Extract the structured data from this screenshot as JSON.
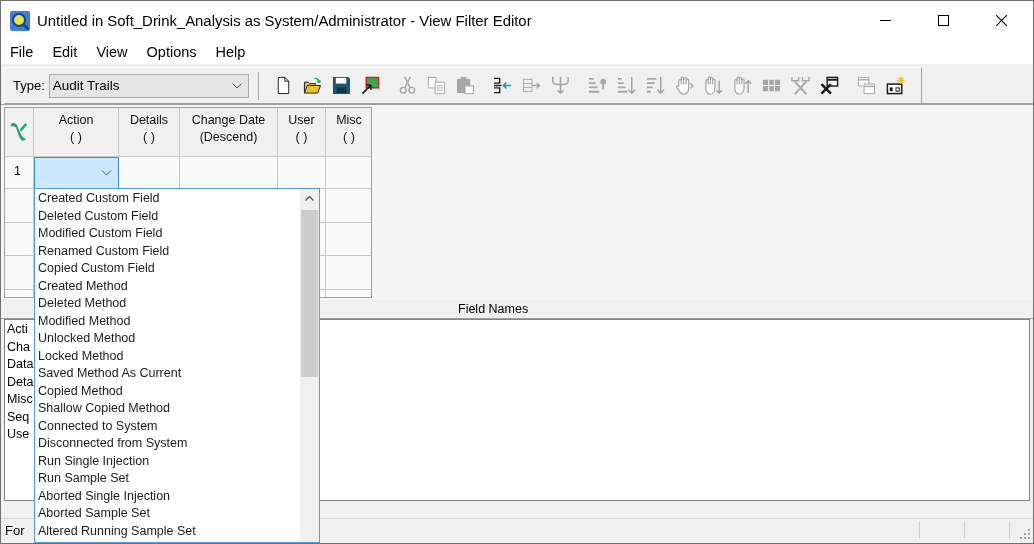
{
  "window": {
    "title": "Untitled in Soft_Drink_Analysis as System/Administrator - View Filter Editor"
  },
  "menu": [
    "File",
    "Edit",
    "View",
    "Options",
    "Help"
  ],
  "toolbar": {
    "type_label": "Type:",
    "type_field": {
      "value": "Audit Trails"
    },
    "button_groups": [
      [
        {
          "kind": "new",
          "disabled": false
        },
        {
          "kind": "open",
          "disabled": false
        },
        {
          "kind": "save",
          "disabled": false
        },
        {
          "kind": "preview",
          "disabled": false
        }
      ],
      [
        {
          "kind": "cut",
          "disabled": true
        },
        {
          "kind": "copy",
          "disabled": true
        },
        {
          "kind": "paste",
          "disabled": true
        }
      ],
      [
        {
          "kind": "insert_column",
          "disabled": false
        },
        {
          "kind": "move_column",
          "disabled": true
        },
        {
          "kind": "branch",
          "disabled": true
        }
      ],
      [
        {
          "kind": "sort_query",
          "disabled": true
        },
        {
          "kind": "sort_ascending",
          "disabled": true
        },
        {
          "kind": "sort_descending",
          "disabled": true
        },
        {
          "kind": "hand",
          "disabled": true
        },
        {
          "kind": "hand_down",
          "disabled": true
        },
        {
          "kind": "hand_up",
          "disabled": true
        },
        {
          "kind": "grid_block",
          "disabled": true
        },
        {
          "kind": "cross_fork",
          "disabled": true
        },
        {
          "kind": "window_x",
          "disabled": false
        }
      ],
      [
        {
          "kind": "windows",
          "disabled": true
        },
        {
          "kind": "sparkle_box",
          "disabled": false
        }
      ]
    ]
  },
  "grid": {
    "columns": [
      {
        "title": "Action",
        "order": "( )"
      },
      {
        "title": "Details",
        "order": "( )"
      },
      {
        "title": "Change Date",
        "order": "(Descend)"
      },
      {
        "title": "User",
        "order": "( )"
      },
      {
        "title": "Misc",
        "order": "( )"
      }
    ],
    "rows": [
      {
        "header": "1",
        "cells": [
          {
            "selected": true
          },
          {
            "selected": false
          },
          {
            "selected": false
          },
          {
            "selected": false
          },
          {
            "selected": false
          }
        ]
      }
    ]
  },
  "dropdown": {
    "items": [
      {
        "label": "Created Custom Field",
        "selected": false
      },
      {
        "label": "Deleted Custom Field",
        "selected": false
      },
      {
        "label": "Modified Custom Field",
        "selected": false
      },
      {
        "label": "Renamed Custom Field",
        "selected": false
      },
      {
        "label": "Copied Custom Field",
        "selected": false
      },
      {
        "label": "Created Method",
        "selected": false
      },
      {
        "label": "Deleted Method",
        "selected": false
      },
      {
        "label": "Modified Method",
        "selected": false
      },
      {
        "label": "Unlocked Method",
        "selected": false
      },
      {
        "label": "Locked Method",
        "selected": false
      },
      {
        "label": "Saved Method As Current",
        "selected": false
      },
      {
        "label": "Copied Method",
        "selected": false
      },
      {
        "label": "Shallow Copied Method",
        "selected": false
      },
      {
        "label": "Connected to System",
        "selected": false
      },
      {
        "label": "Disconnected from System",
        "selected": false
      },
      {
        "label": "Run Single Injection",
        "selected": false
      },
      {
        "label": "Run Sample Set",
        "selected": false
      },
      {
        "label": "Aborted Single Injection",
        "selected": false
      },
      {
        "label": "Aborted Sample Set",
        "selected": false
      },
      {
        "label": "Altered Running Sample Set",
        "selected": false
      }
    ]
  },
  "field_names": {
    "title": "Field Names",
    "items": [
      {
        "label": "Acti",
        "selected": false
      },
      {
        "label": "Cha",
        "selected": false
      },
      {
        "label": "Data",
        "selected": false
      },
      {
        "label": "Deta",
        "selected": false
      },
      {
        "label": "Misc",
        "selected": false
      },
      {
        "label": "Seq",
        "selected": false
      },
      {
        "label": "Use",
        "selected": false
      }
    ]
  },
  "status_bar": {
    "text": "For"
  }
}
